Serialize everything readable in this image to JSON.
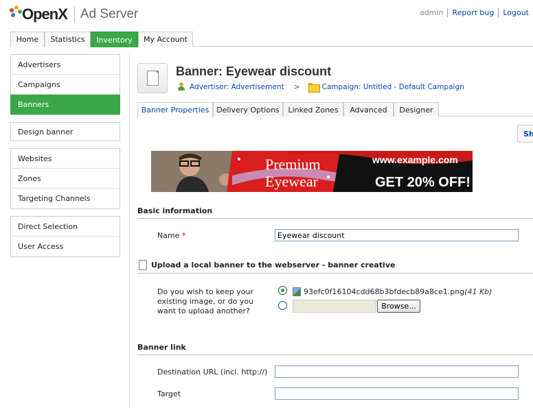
{
  "brand": {
    "logo_text": "OpenX",
    "product": "Ad Server"
  },
  "top_links": {
    "user": "admin",
    "report_bug": "Report bug",
    "logout": "Logout"
  },
  "main_tabs": [
    "Home",
    "Statistics",
    "Inventory",
    "My Account"
  ],
  "sidebar": {
    "group1": [
      "Advertisers",
      "Campaigns",
      "Banners"
    ],
    "group2": [
      "Design banner"
    ],
    "group3": [
      "Websites",
      "Zones",
      "Targeting Channels"
    ],
    "group4": [
      "Direct Selection",
      "User Access"
    ]
  },
  "page": {
    "title": "Banner: Eyewear discount",
    "advertiser": "Advertiser: Advertisement",
    "crumb_arrow": ">",
    "campaign": "Campaign: Untitled - Default Campaign"
  },
  "sub_tabs": [
    "Banner Properties",
    "Delivery Options",
    "Linked Zones",
    "Advanced",
    "Designer"
  ],
  "side_button": "Sh",
  "banner_ad": {
    "headline_1": "Premium",
    "headline_2": "Eyewear",
    "url": "www.example.com",
    "offer": "GET 20% OFF!"
  },
  "basic_info": {
    "title": "Basic information",
    "name_label": "Name",
    "required_mark": "*",
    "name_value": "Eyewear discount"
  },
  "upload": {
    "title": "Upload a local banner to the webserver - banner creative",
    "question": "Do you wish to keep your existing image, or do you want to upload another?",
    "filename": "93efc0f16104cdd68b3bfdecb89a8ce1.png",
    "filesize": "(41 Kb)",
    "browse": "Browse..."
  },
  "banner_link": {
    "title": "Banner link",
    "dest_label": "Destination URL (incl. http://)",
    "dest_value": "",
    "target_label": "Target",
    "target_value": ""
  },
  "colors": {
    "accent_green": "#3aa847",
    "link_blue": "#0645ad"
  }
}
